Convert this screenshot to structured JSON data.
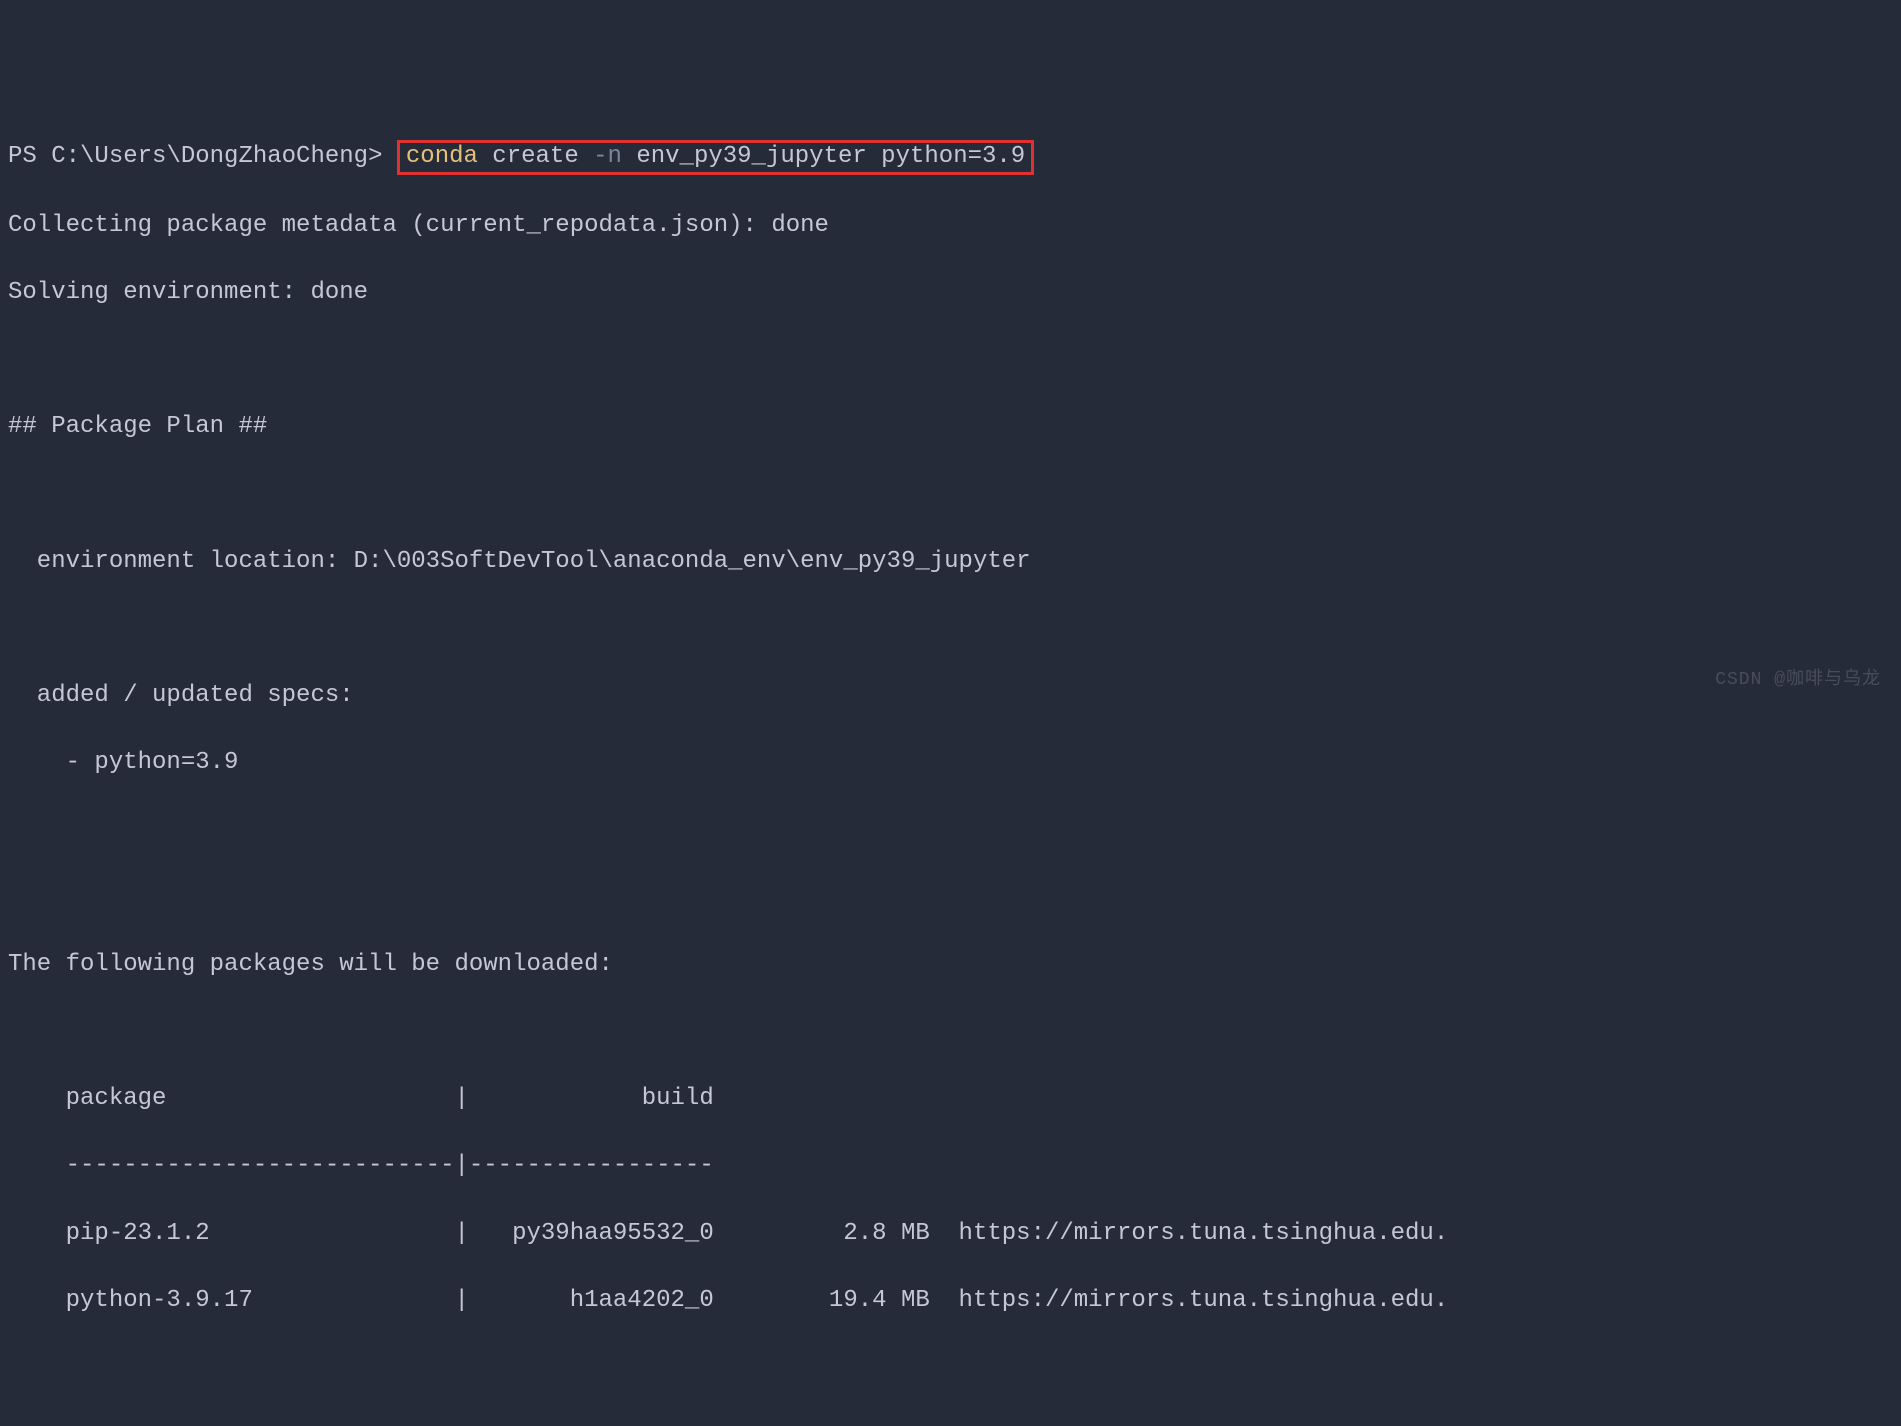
{
  "prompt": {
    "ps": "PS ",
    "path": "C:\\Users\\DongZhaoCheng",
    "gt": "> "
  },
  "command": {
    "conda": "conda",
    "create": " create ",
    "flag": "-n",
    "rest": " env_py39_jupyter python=3.9"
  },
  "output": {
    "collecting": "Collecting package metadata (current_repodata.json): done",
    "solving": "Solving environment: done",
    "plan_header": "## Package Plan ##",
    "env_location": "  environment location: D:\\003SoftDevTool\\anaconda_env\\env_py39_jupyter",
    "added_specs": "  added / updated specs:",
    "spec1": "    - python=3.9",
    "download_header": "The following packages will be downloaded:",
    "table_header": "    package                    |            build",
    "table_divider": "    ---------------------------|-----------------",
    "pkg1": "    pip-23.1.2                 |   py39haa95532_0         2.8 MB  https://mirrors.tuna.tsinghua.edu.",
    "pkg2": "    python-3.9.17              |       h1aa4202_0        19.4 MB  https://mirrors.tuna.tsinghua.edu."
  },
  "watermark": "CSDN @咖啡与乌龙"
}
